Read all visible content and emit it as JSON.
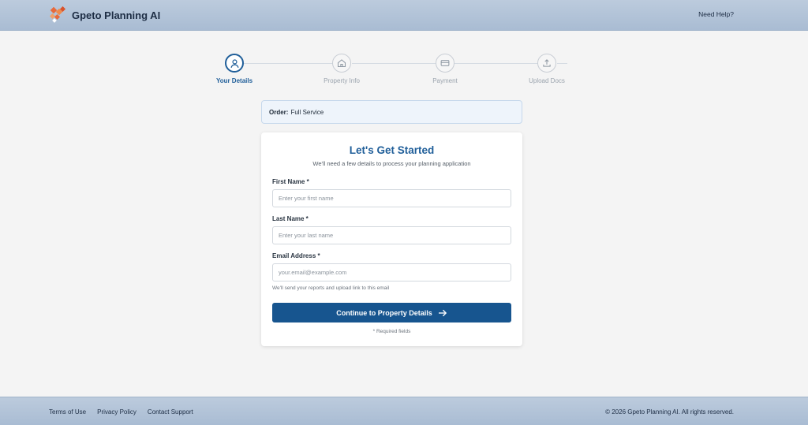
{
  "header": {
    "brand_name": "Gpeto Planning AI",
    "help_link": "Need Help?"
  },
  "stepper": {
    "steps": [
      {
        "label": "Your Details",
        "icon": "user-icon",
        "active": true
      },
      {
        "label": "Property Info",
        "icon": "home-icon",
        "active": false
      },
      {
        "label": "Payment",
        "icon": "credit-card-icon",
        "active": false
      },
      {
        "label": "Upload Docs",
        "icon": "upload-icon",
        "active": false
      }
    ]
  },
  "order": {
    "label": "Order:",
    "value": "Full Service"
  },
  "form": {
    "title": "Let's Get Started",
    "subtitle": "We'll need a few details to process your planning application",
    "first_name": {
      "label": "First Name *",
      "placeholder": "Enter your first name",
      "value": ""
    },
    "last_name": {
      "label": "Last Name *",
      "placeholder": "Enter your last name",
      "value": ""
    },
    "email": {
      "label": "Email Address *",
      "placeholder": "your.email@example.com",
      "value": "",
      "hint": "We'll send your reports and upload link to this email"
    },
    "submit_label": "Continue to Property Details",
    "required_note": "* Required fields"
  },
  "footer": {
    "links": [
      "Terms of Use",
      "Privacy Policy",
      "Contact Support"
    ],
    "copyright": "© 2026 Gpeto Planning AI. All rights reserved."
  },
  "colors": {
    "accent": "#1f5e99",
    "button": "#17558f",
    "header_bg": "#b3c4d8",
    "logo_orange": "#e8693a"
  }
}
